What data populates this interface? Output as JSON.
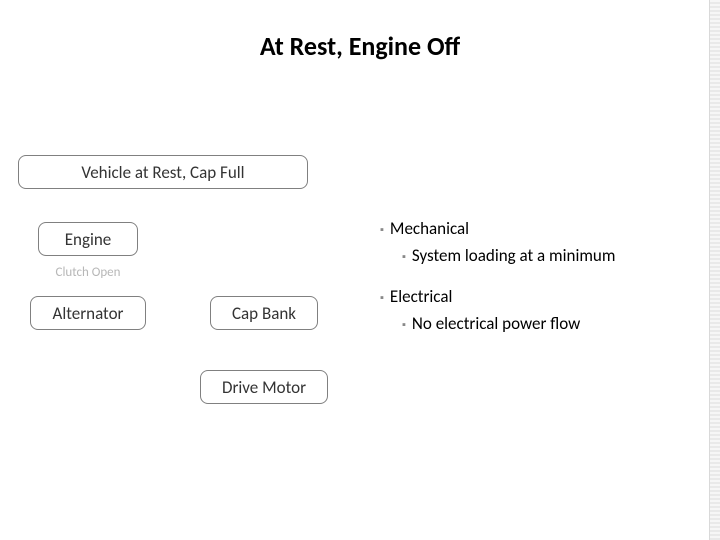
{
  "title": "At Rest, Engine Off",
  "nodes": {
    "vehicle": "Vehicle at Rest, Cap Full",
    "engine": "Engine",
    "clutch": "Clutch Open",
    "alternator": "Alternator",
    "capbank": "Cap Bank",
    "drivemotor": "Drive Motor"
  },
  "bullets": {
    "mech_h": "Mechanical",
    "mech_1": "System loading at a minimum",
    "elec_h": "Electrical",
    "elec_1": "No electrical power flow"
  }
}
